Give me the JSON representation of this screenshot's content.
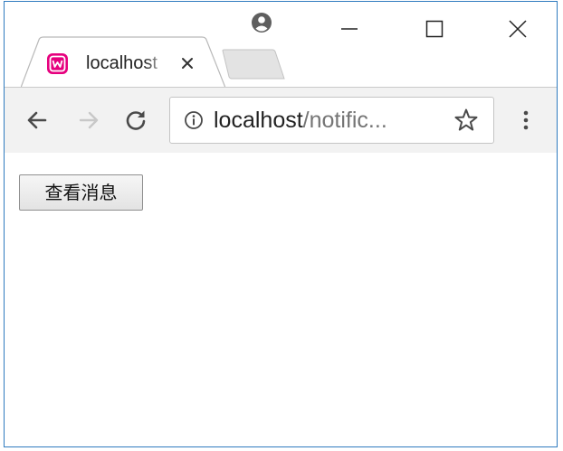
{
  "browser": {
    "tab": {
      "title": "localhost",
      "favicon": "wampserver-w-icon",
      "favicon_color": "#e6007e",
      "close_glyph": "×"
    },
    "address_bar": {
      "host": "localhost",
      "path": "/notific..."
    },
    "icons": {
      "profile": "user-profile-icon",
      "minimize": "minimize-icon",
      "maximize": "maximize-icon",
      "close": "close-icon",
      "back": "back-arrow-icon",
      "forward": "forward-arrow-icon",
      "reload": "reload-icon",
      "info": "info-icon",
      "bookmark": "star-icon",
      "menu": "kebab-menu-icon"
    },
    "colors": {
      "window_border": "#2f7bbf",
      "toolbar_bg": "#f2f2f2",
      "url_path": "#757575"
    }
  },
  "page": {
    "view_messages_button_label": "查看消息"
  }
}
